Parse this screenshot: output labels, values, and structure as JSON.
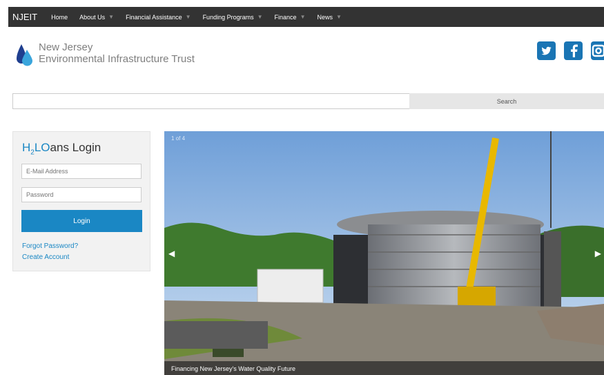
{
  "topbar": {
    "brand": "NJEIT",
    "nav": [
      {
        "label": "Home",
        "has_dropdown": false
      },
      {
        "label": "About Us",
        "has_dropdown": true
      },
      {
        "label": "Financial Assistance",
        "has_dropdown": true
      },
      {
        "label": "Funding Programs",
        "has_dropdown": true
      },
      {
        "label": "Finance",
        "has_dropdown": true
      },
      {
        "label": "News",
        "has_dropdown": true
      }
    ]
  },
  "logo": {
    "line1": "New Jersey",
    "line2": "Environmental Infrastructure Trust"
  },
  "social": [
    "twitter-icon",
    "facebook-icon",
    "instagram-icon"
  ],
  "search": {
    "placeholder": "",
    "button_label": "Search"
  },
  "login": {
    "title_h": "H",
    "title_sub": "2",
    "title_lo": "LO",
    "title_rest": "ans Login",
    "email_placeholder": "E-Mail Address",
    "password_placeholder": "Password",
    "button_label": "Login",
    "forgot_label": "Forgot Password?",
    "create_label": "Create Account"
  },
  "slider": {
    "counter": "1 of 4",
    "caption": "Financing New Jersey's Water Quality Future"
  },
  "colors": {
    "topbar": "#333333",
    "accent": "#1a87c4",
    "social": "#1a75b4"
  }
}
